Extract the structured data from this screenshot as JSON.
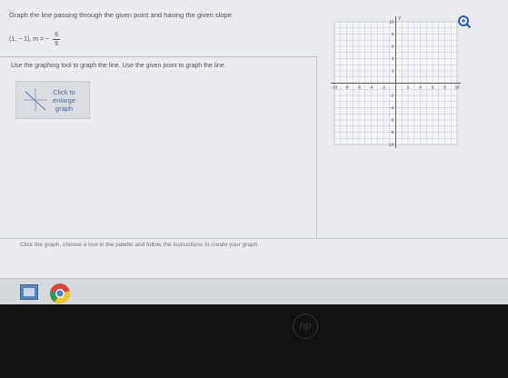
{
  "question": {
    "prompt": "Graph the line passing through the given point and having the given slope.",
    "point": "(1, − 1), m = −",
    "slope_num": "6",
    "slope_den": "5",
    "instruction": "Use the graphing tool to graph the line. Use the given point to graph the line."
  },
  "thumbnail": {
    "label_line1": "Click to",
    "label_line2": "enlarge",
    "label_line3": "graph"
  },
  "graph": {
    "x_label": "x",
    "y_label": "y",
    "x_ticks": [
      "-10",
      "-8",
      "-6",
      "-4",
      "-2",
      "2",
      "4",
      "6",
      "8",
      "10"
    ],
    "y_ticks": [
      "10",
      "8",
      "6",
      "4",
      "2",
      "-2",
      "-4",
      "-6",
      "-8",
      "-10"
    ],
    "range": [
      -10,
      10
    ]
  },
  "footer": {
    "hint": "Click the graph, choose a tool in the palette and follow the instructions to create your graph."
  },
  "colors": {
    "link": "#4c6ca0",
    "zoom": "#2a5db0",
    "chrome_red": "#d9453a"
  },
  "icons": [
    "zoom-icon",
    "graph-thumbnail-icon",
    "file-explorer-icon",
    "chrome-icon",
    "hp-logo"
  ]
}
